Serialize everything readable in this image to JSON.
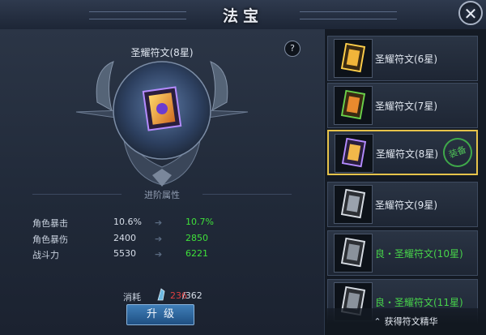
{
  "window": {
    "title": "法宝"
  },
  "selected_item": {
    "name": "圣耀符文(8星)"
  },
  "help_label": "?",
  "close_label": "✕",
  "section": {
    "title": "进阶属性"
  },
  "attributes": [
    {
      "label": "角色暴击",
      "current": "10.6%",
      "next": "10.7%"
    },
    {
      "label": "角色暴伤",
      "current": "2400",
      "next": "2850"
    },
    {
      "label": "战斗力",
      "current": "5530",
      "next": "6221"
    }
  ],
  "cost": {
    "label": "消耗",
    "have": "236",
    "need": "/362"
  },
  "upgrade_button": {
    "label": "升级"
  },
  "list": {
    "items": [
      {
        "name": "圣耀符文(6星)",
        "rarity": "gold",
        "selected": false
      },
      {
        "name": "圣耀符文(7星)",
        "rarity": "gold",
        "selected": false
      },
      {
        "name": "圣耀符文(8星)",
        "rarity": "purple",
        "selected": true,
        "badge": "装备"
      },
      {
        "name": "圣耀符文(9星)",
        "rarity": "silver",
        "selected": false
      },
      {
        "name": "良・圣耀符文(10星)",
        "rarity": "silver",
        "selected": false
      },
      {
        "name": "良・圣耀符文(11星)",
        "rarity": "silver",
        "selected": false
      }
    ]
  },
  "obtain_button": {
    "label": "获得符文精华"
  },
  "colors": {
    "accent_gold": "#e6c34a",
    "increase_green": "#3fe03a",
    "insufficient_red": "#e04040"
  }
}
